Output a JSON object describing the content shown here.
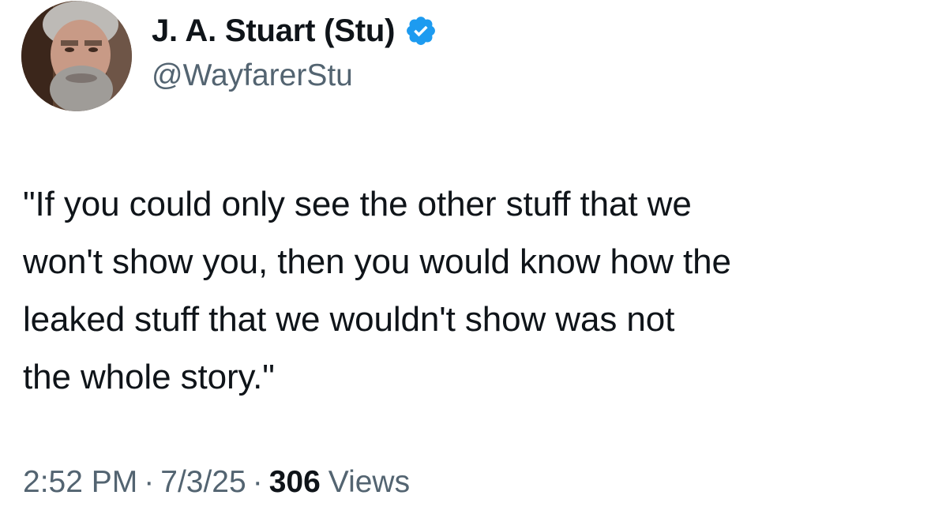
{
  "author": {
    "display_name": "J. A. Stuart (Stu)",
    "handle": "@WayfarerStu",
    "verified": true,
    "verified_color": "#1d9bf0"
  },
  "tweet": {
    "text": "\"If you could only see the other stuff that we\nwon't show you, then you would know how the\nleaked stuff that we wouldn't show was not\nthe whole story.\""
  },
  "meta": {
    "time": "2:52 PM",
    "separator": "·",
    "date": "7/3/25",
    "views_count": "306",
    "views_label": "Views"
  },
  "colors": {
    "text_primary": "#0f1419",
    "text_secondary": "#536471",
    "background": "#ffffff"
  }
}
